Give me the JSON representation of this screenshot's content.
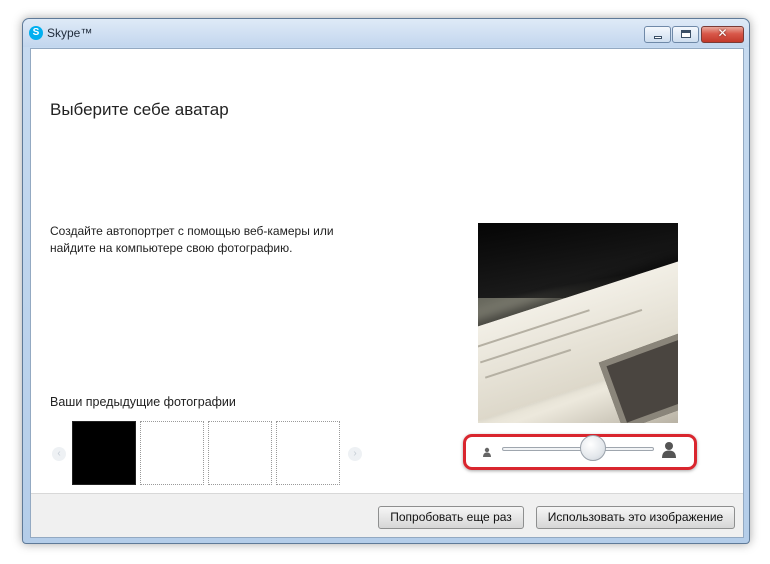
{
  "window": {
    "app_title": "Skype™",
    "app_icon": "skype-logo-icon",
    "controls": [
      "minimize-icon",
      "maximize-icon",
      "close-icon"
    ],
    "close_glyph": "✕"
  },
  "main": {
    "heading": "Выберите себе аватар",
    "description": "Создайте автопортрет с помощью веб-камеры или найдите на компьютере свою фотографию."
  },
  "previous_photos": {
    "title": "Ваши предыдущие фотографии",
    "prev_arrow": "‹",
    "next_arrow": "›",
    "slots": [
      "filled",
      "empty",
      "empty",
      "empty"
    ]
  },
  "zoom": {
    "min_icon": "person-small-icon",
    "max_icon": "person-large-icon",
    "level": 0.6,
    "highlight_color": "#d9262e"
  },
  "footer": {
    "retry_label": "Попробовать еще раз",
    "use_label": "Использовать это изображение"
  },
  "colors": {
    "skype_blue": "#00aff0",
    "close_red": "#c2382a"
  }
}
